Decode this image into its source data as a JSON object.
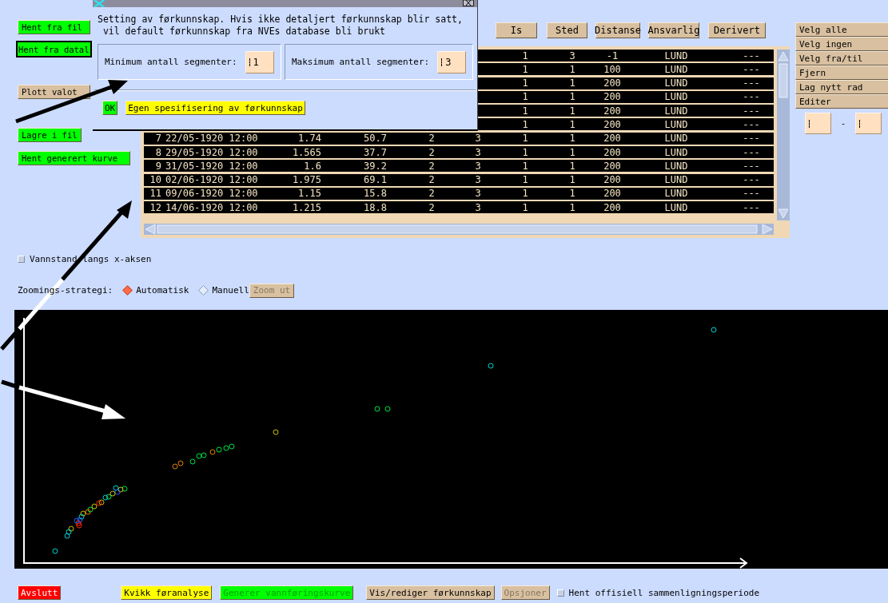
{
  "left_buttons": [
    {
      "label": "Hent fra fil",
      "color": "#00ff00",
      "default": false
    },
    {
      "label": "Hent fra datal",
      "color": "#00ff00",
      "default": true
    },
    {
      "label": "Plott valot",
      "color": "#d8c0a0",
      "default": false
    },
    {
      "label": "Lagre i fil",
      "color": "#00ff00",
      "default": false
    },
    {
      "label": "Hent generert kurve",
      "color": "#00ff00",
      "default": false
    }
  ],
  "table": {
    "columns": [
      "Is",
      "Sted",
      "Distanse",
      "Ansvarlig",
      "Derivert"
    ],
    "rows": [
      {
        "cells": [
          "1",
          "3",
          "-1",
          "LUND",
          "---"
        ]
      },
      {
        "cells": [
          "1",
          "1",
          "100",
          "LUND",
          "---"
        ]
      },
      {
        "cells": [
          "1",
          "1",
          "200",
          "LUND",
          "---"
        ]
      },
      {
        "cells": [
          "1",
          "1",
          "200",
          "LUND",
          "---"
        ]
      },
      {
        "cells": [
          "1",
          "1",
          "200",
          "LUND",
          "---"
        ]
      },
      {
        "cells": [
          "1",
          "1",
          "200",
          "LUND",
          "---"
        ]
      },
      {
        "cells": [
          "7",
          "22/05-1920 12:00",
          "1.74",
          "50.7",
          "2",
          "3",
          "1",
          "1",
          "200",
          "LUND",
          "---"
        ]
      },
      {
        "cells": [
          "8",
          "29/05-1920 12:00",
          "1.565",
          "37.7",
          "2",
          "3",
          "1",
          "1",
          "200",
          "LUND",
          "---"
        ]
      },
      {
        "cells": [
          "9",
          "31/05-1920 12:00",
          "1.6",
          "39.2",
          "2",
          "3",
          "1",
          "1",
          "200",
          "LUND",
          "---"
        ]
      },
      {
        "cells": [
          "10",
          "02/06-1920 12:00",
          "1.975",
          "69.1",
          "2",
          "3",
          "1",
          "1",
          "200",
          "LUND",
          "---"
        ]
      },
      {
        "cells": [
          "11",
          "09/06-1920 12:00",
          "1.15",
          "15.8",
          "2",
          "3",
          "1",
          "1",
          "200",
          "LUND",
          "---"
        ]
      },
      {
        "cells": [
          "12",
          "14/06-1920 12:00",
          "1.215",
          "18.8",
          "2",
          "3",
          "1",
          "1",
          "200",
          "LUND",
          "---"
        ]
      }
    ]
  },
  "side_buttons": [
    "Velg alle",
    "Velg ingen",
    "Velg fra/til",
    "Fjern",
    "Lag nytt rad",
    "Editer"
  ],
  "range": {
    "separator": "-"
  },
  "dialog": {
    "message": "Setting av førkunnskap. Hvis ikke detaljert førkunnskap blir satt,\n vil default førkunnskap fra NVEs database bli brukt",
    "fields": [
      {
        "label": "Minimum antall segmenter:",
        "value": "1"
      },
      {
        "label": "Maksimum antall segmenter:",
        "value": "3"
      }
    ],
    "buttons": [
      {
        "label": "OK",
        "color": "#00ff00"
      },
      {
        "label": "Egen spesifisering av førkunnskap",
        "color": "#ffff00"
      }
    ]
  },
  "plot_options": {
    "checkbox": {
      "label": "Vannstand langs x-aksen",
      "checked": false
    },
    "zoom_label": "Zoomings-strategi:",
    "zoom_options": [
      {
        "label": "Automatisk",
        "selected": true
      },
      {
        "label": "Manuell",
        "selected": false
      }
    ],
    "zoom_button": {
      "label": "Zoom ut",
      "disabled": true
    }
  },
  "bottom_bar": {
    "buttons": [
      {
        "label": "Avslutt",
        "color": "#ff0000",
        "disabled": false
      },
      {
        "label": "Kvikk føranalyse",
        "color": "#ffff00",
        "disabled": false
      },
      {
        "label": "Generer vannføringskurve",
        "color": "#00ff00",
        "disabled": true
      },
      {
        "label": "Vis/rediger førkunnskap",
        "color": "#d8c0a0",
        "disabled": false
      },
      {
        "label": "Opsjoner",
        "color": "#d8c0a0",
        "disabled": true
      }
    ],
    "checkbox": {
      "label": "Hent offisiell sammenligningsperiode",
      "checked": false
    }
  }
}
